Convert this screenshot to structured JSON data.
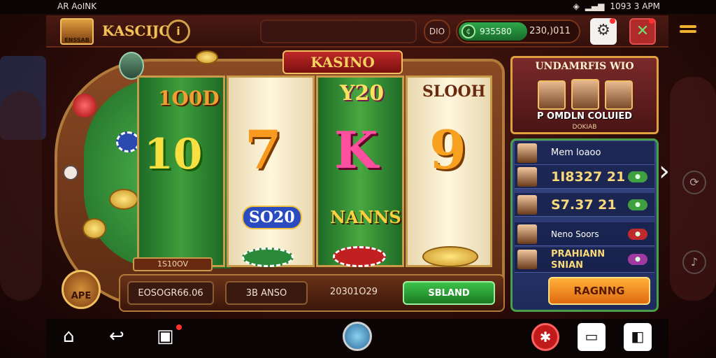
{
  "status_bar": {
    "left": "AR AoINK",
    "time": "1093 3 APM"
  },
  "header": {
    "logo_text": "KASCIJO",
    "logo_badge": "ENSSAB",
    "id_label": "DIO",
    "balance_green": "935580",
    "balance_total": "230,)011"
  },
  "machine": {
    "banner": "KASINO",
    "symbols": [
      "1O0D",
      "10",
      "7",
      "Y20",
      "K",
      "SLOOH",
      "9",
      "SO20",
      "NANNS"
    ],
    "tag": "1S10OV",
    "ape_label": "APE"
  },
  "controls": {
    "field1": "EOSOGR66.06",
    "field2": "3B ANSO",
    "field3": "20301O29",
    "spin_button": "SBLAND"
  },
  "promo": {
    "title": "UNDAMRFIS WIO",
    "line": "P OMDLN COLUIED",
    "sub": "DOKIAB"
  },
  "leaderboard": {
    "rows": [
      {
        "text": "Mem loaoo"
      },
      {
        "text": "1I8327 21"
      },
      {
        "text": "S7.37 21"
      },
      {
        "text": "Neno Soors"
      },
      {
        "text": "PRAHIANN SNIAN"
      }
    ],
    "button": "RAGNNG"
  }
}
